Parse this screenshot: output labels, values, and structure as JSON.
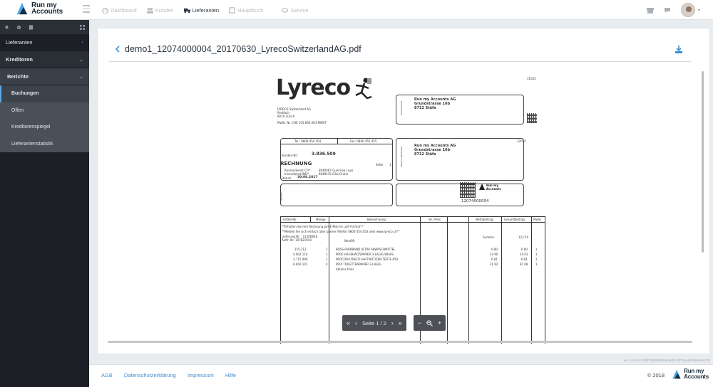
{
  "app": {
    "logo_line1": "Run my",
    "logo_line2": "Accounts"
  },
  "nav": [
    {
      "label": "Dashboard",
      "icon": "dashboard-icon"
    },
    {
      "label": "Kunden",
      "icon": "users-icon"
    },
    {
      "label": "Lieferanten",
      "icon": "truck-icon"
    },
    {
      "label": "Hauptbuch",
      "icon": "book-icon"
    },
    {
      "label": "Service",
      "icon": "service-icon"
    }
  ],
  "sidebar": {
    "items": [
      {
        "label": "Lieferanten"
      },
      {
        "label": "Kreditoren"
      },
      {
        "label": "Berichte"
      }
    ],
    "sub": [
      {
        "label": "Buchungen"
      },
      {
        "label": "Offen"
      },
      {
        "label": "Kreditorenspiegel"
      },
      {
        "label": "Lieferantenstatistik"
      }
    ]
  },
  "document": {
    "title": "demo1_12074000004_20170630_LyrecoSwitzerlandAG.pdf",
    "page_label": "Seite 1 / 2",
    "invoice": {
      "brand": "Lyreco",
      "number_top": "11025",
      "sender": "LYRECO Switzerland AG",
      "sender_addr1": "Postfach",
      "sender_addr2": "8010 Zürich",
      "mwst": "MwSt. Nr. CHE 105.060.003 MWST",
      "recipient1": "Run my Accounts AG",
      "recipient2": "Grundstrasse 16b",
      "recipient3": "8712 Stäfa",
      "tel": "Tel.: 0800 454 454",
      "fax": "Fax: 0800 455 455",
      "kunden_label": "Kunden-Nr.:",
      "kunden_nr": "3.836.509",
      "rechnung": "RECHNUNG",
      "seite_label": "Seite",
      "seite": "1",
      "aussendienst": "Aussendienst CO*",
      "aussendienst_val": "8040067 Guerinoa Lupo",
      "innendienst": "Innendienst IND*",
      "innendienst_val": "8040435 Cilia Gruhe",
      "datum_label": "Datum",
      "datum": "30.06.2017",
      "ref_label": "12074",
      "barcode_number": "12074000004",
      "side_label1": "Lieferadresse",
      "side_label2": "Rechnungsadresse",
      "side_label3": "Bestellt",
      "cols": [
        "Artikel-Nr.",
        "Menge",
        "Bezeichnung",
        "Ve. Preis",
        "Nettobetrag",
        "Gesamtbetrag",
        "MwSt"
      ],
      "notes": [
        "**Erhalten Sie Ihre Rechnung per E-Mail im .pdf Format**",
        "**Melden Sie sich einfach über unsere Telefon 0800 454 454 oder www.lyreco.ch**",
        "Lieferung Nr. : 11206858",
        "Auftr.-Nr. 107821919"
      ],
      "neu_label": "Neu(M)",
      "summe_label": "Summe:",
      "summe": "123.54",
      "rows": [
        {
          "art": "155.213",
          "qty": "1",
          "desc": "BOSS-FARBBAND ULTRA ABWASCHMITTEL",
          "net": "6.80",
          "total": "6.80",
          "mwst": "1"
        },
        {
          "art": "4.002.116",
          "qty": "1",
          "desc": "PROF HAUSHALTSPAPIER 3-LAGIG WEISS",
          "net": "24.90",
          "total": "24.03",
          "mwst": "1"
        },
        {
          "art": "2.715.499",
          "qty": "1",
          "desc": "PROCOM LYRECO HAFTNOTIZEN TEXTE A50",
          "net": "6.81",
          "total": "6.81",
          "mwst": "1"
        },
        {
          "art": "6.002.101",
          "qty": "4",
          "desc": "PRIX TOILETTENPAPIER 3-LAGIG",
          "net": "21.92",
          "total": "87.08",
          "mwst": "1"
        }
      ],
      "aktion": "Aktions Preis"
    }
  },
  "pdf_controls": {
    "first": "«",
    "prev": "‹",
    "next": "›",
    "last": "»",
    "zoom_out": "−",
    "zoom_reset": "search-icon",
    "zoom_in": "+"
  },
  "footer": {
    "links": [
      "AGB",
      "Datenschutzerklärung",
      "Impressum",
      "Hilfe"
    ],
    "copyright": "© 2018",
    "logo_line1": "Run my",
    "logo_line2": "Accounts"
  },
  "version": "ver. 3.3.15 | f4c8f7b6f55d36b9c8d9142f76be4e5356c9e5703"
}
